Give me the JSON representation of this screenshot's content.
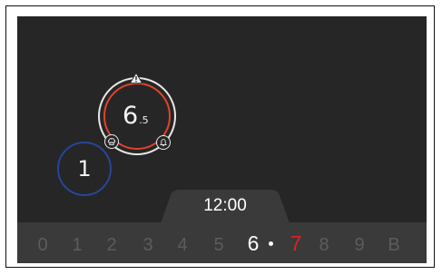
{
  "zone_main": {
    "level_whole": "6",
    "level_decimal": ".5",
    "icons": [
      "warning-icon",
      "chef-hat-icon",
      "bell-icon"
    ],
    "colors": {
      "outer_ring": "#e8e8e8",
      "inner_ring": "#e0432a"
    }
  },
  "zone_small": {
    "level": "1",
    "ring_color": "#27459a"
  },
  "timer": {
    "value": "12:00"
  },
  "slider": {
    "items": [
      "0",
      "1",
      "2",
      "3",
      "4",
      "5",
      "6",
      "7",
      "8",
      "9",
      "B"
    ],
    "selected": "6",
    "limit": "7",
    "colors": {
      "inactive": "#5c5c5c",
      "selected": "#ffffff",
      "limit": "#e02020"
    }
  }
}
